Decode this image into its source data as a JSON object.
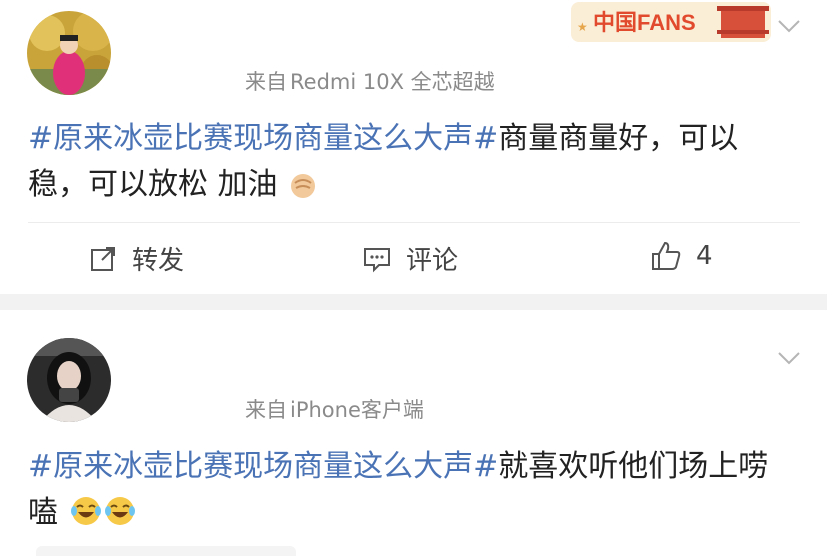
{
  "posts": [
    {
      "source_prefix": "来自",
      "source_app": "Redmi 10X 全芯超越",
      "hashtag": "#原来冰壶比赛现场商量这么大声#",
      "body": "商量商量好，可以稳，可以放松 加油",
      "emojis": [
        "fist-emoji"
      ],
      "badge_text": "中国FANS",
      "actions": {
        "repost": "转发",
        "comment": "评论",
        "like_count": "4"
      }
    },
    {
      "source_prefix": "来自",
      "source_app": "iPhone客户端",
      "hashtag": "#原来冰壶比赛现场商量这么大声#",
      "body": "就喜欢听他们场上唠嗑",
      "emojis": [
        "laugh-cry-emoji",
        "laugh-cry-emoji"
      ]
    }
  ],
  "colors": {
    "hashtag": "#4a73b5",
    "meta": "#8a8a8a",
    "separator": "#f2f2f2"
  }
}
